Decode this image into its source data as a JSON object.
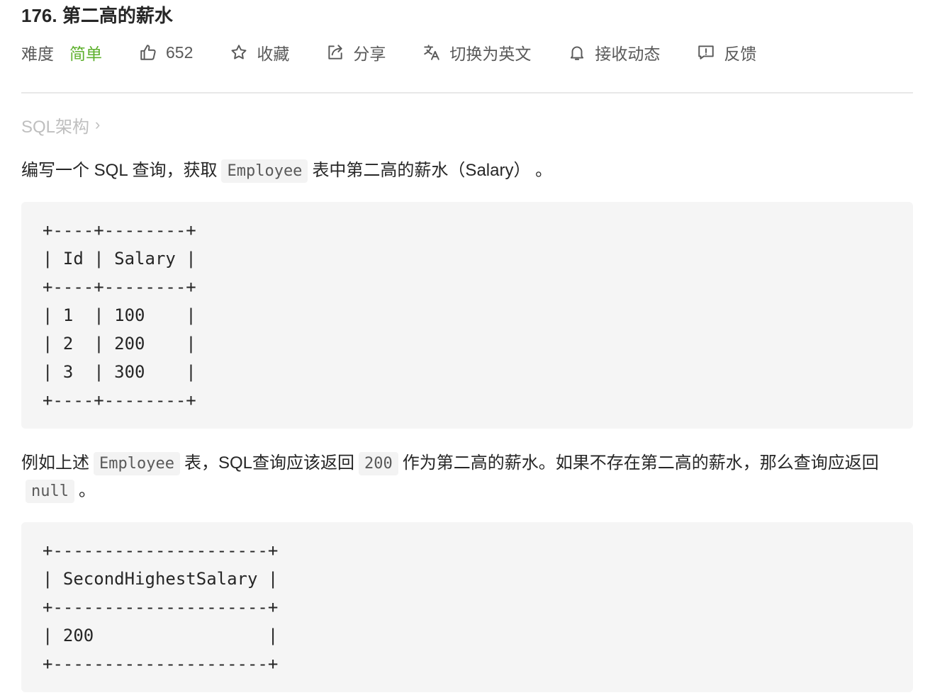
{
  "problem": {
    "title": "176. 第二高的薪水"
  },
  "toolbar": {
    "difficulty_label": "难度",
    "difficulty_value": "简单",
    "likes": "652",
    "favorite": "收藏",
    "share": "分享",
    "translate": "切换为英文",
    "subscribe": "接收动态",
    "feedback": "反馈",
    "icons": [
      "thumbs-up-icon",
      "star-icon",
      "share-icon",
      "translate-icon",
      "bell-icon",
      "feedback-icon"
    ],
    "difficulty_color": "#5fb12f"
  },
  "breadcrumb": {
    "label": "SQL架构",
    "arrow": "›"
  },
  "description": {
    "p1_before": "编写一个 SQL 查询，获取",
    "p1_code": "Employee",
    "p1_after": "表中第二高的薪水（Salary） 。",
    "p2_before": "例如上述",
    "p2_code": "Employee",
    "p2_mid": "表，SQL查询应该返回",
    "p2_code2": "200",
    "p2_after": "作为第二高的薪水。如果不存在第二高的薪水，那么查询应返回",
    "p2_code3": "null",
    "p2_end": "。"
  },
  "code_blocks": {
    "input_table": "+----+--------+\n| Id | Salary |\n+----+--------+\n| 1  | 100    |\n| 2  | 200    |\n| 3  | 300    |\n+----+--------+",
    "output_table": "+---------------------+\n| SecondHighestSalary |\n+---------------------+\n| 200                 |\n+---------------------+"
  }
}
